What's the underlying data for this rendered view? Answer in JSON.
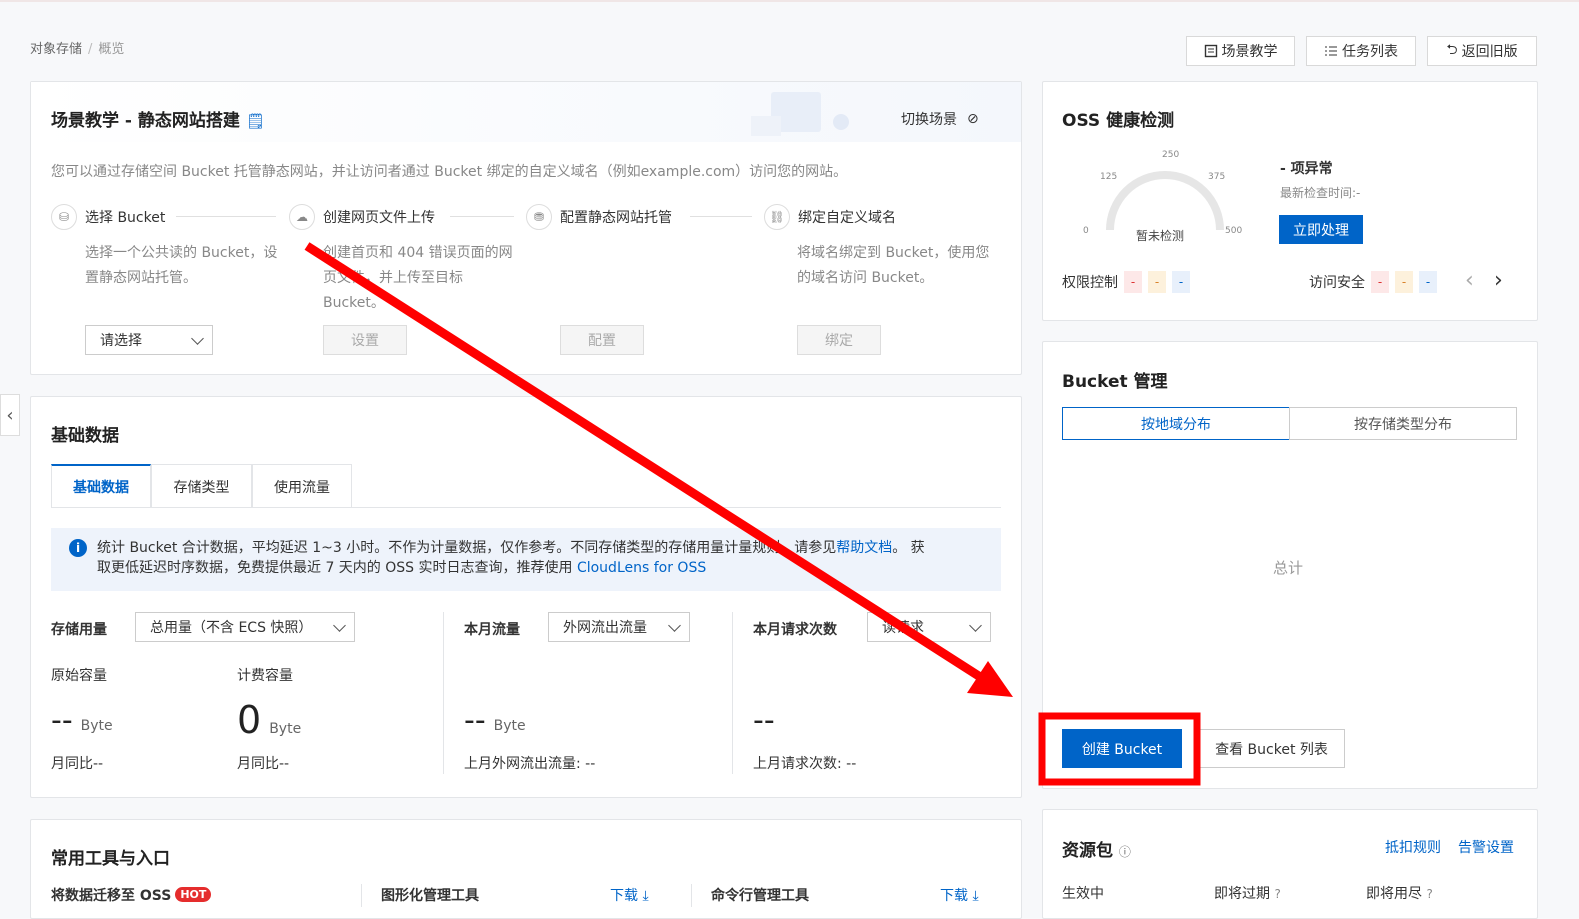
{
  "breadcrumb": {
    "root": "对象存储",
    "separator": "/",
    "current": "概览"
  },
  "toolbar": {
    "scene_teaching": "场景教学",
    "task_list": "任务列表",
    "back_old": "返回旧版"
  },
  "scene": {
    "title": "场景教学 - 静态网站搭建",
    "switch_label": "切换场景",
    "description": "您可以通过存储空间 Bucket 托管静态网站，并让访问者通过 Bucket 绑定的自定义域名（例如example.com）访问您的网站。",
    "steps": [
      {
        "title": "选择 Bucket",
        "desc_lines": [
          "选择一个公共读的 Bucket，设",
          "置静态网站托管。"
        ],
        "action": "请选择"
      },
      {
        "title": "创建网页文件上传",
        "desc_lines": [
          "创建首页和 404 错误页面的网",
          "页文件，并上传至目标",
          "Bucket。"
        ],
        "action": "设置"
      },
      {
        "title": "配置静态网站托管",
        "desc_lines": [],
        "action": "配置"
      },
      {
        "title": "绑定自定义域名",
        "desc_lines": [
          "将域名绑定到 Bucket，使用您",
          "的域名访问 Bucket。"
        ],
        "action": "绑定"
      }
    ]
  },
  "health": {
    "title": "OSS 健康检测",
    "gauge": {
      "ticks": [
        "0",
        "125",
        "250",
        "375",
        "500"
      ],
      "center": "暂未检测"
    },
    "abnormal": "- 项异常",
    "last_check": "最新检查时间:-",
    "handle_btn": "立即处理",
    "perm_label": "权限控制",
    "access_label": "访问安全",
    "tag_value": "-"
  },
  "basic": {
    "title": "基础数据",
    "tabs": [
      "基础数据",
      "存储类型",
      "使用流量"
    ],
    "notice_pre": "统计 Bucket 合计数据，平均延迟 1~3 小时。不作为计量数据，仅作参考。不同存储类型的存储用量计量规则，请参见",
    "notice_link1": "帮助文档",
    "notice_mid": "。 获",
    "notice_line2": "取更低延迟时序数据，免费提供最近 7 天内的 OSS 实时日志查询，推荐使用 ",
    "notice_link2": "CloudLens for OSS",
    "storage_label": "存储用量",
    "storage_select": "总用量（不含 ECS 快照）",
    "raw_cap_label": "原始容量",
    "raw_cap_value": "--",
    "raw_cap_unit": "Byte",
    "raw_cap_mom": "月同比--",
    "bill_cap_label": "计费容量",
    "bill_cap_value": "0",
    "bill_cap_unit": "Byte",
    "bill_cap_mom": "月同比--",
    "traffic_label": "本月流量",
    "traffic_select": "外网流出流量",
    "traffic_value": "--",
    "traffic_unit": "Byte",
    "traffic_last": "上月外网流出流量: --",
    "req_label": "本月请求次数",
    "req_select": "读请求",
    "req_value": "--",
    "req_last": "上月请求次数: --"
  },
  "bucket": {
    "title": "Bucket 管理",
    "tab_region": "按地域分布",
    "tab_type": "按存储类型分布",
    "total": "总计",
    "create_btn": "创建 Bucket",
    "list_btn": "查看 Bucket 列表"
  },
  "tools": {
    "title": "常用工具与入口",
    "migrate": "将数据迁移至 OSS",
    "hot": "HOT",
    "gui_tool": "图形化管理工具",
    "cli_tool": "命令行管理工具",
    "download": "下载"
  },
  "resource": {
    "title": "资源包",
    "rules": "抵扣规则",
    "alarm": "告警设置",
    "active": "生效中",
    "expiring": "即将过期",
    "exhausting": "即将用尽"
  },
  "colors": {
    "primary": "#0064c8",
    "annotation_red": "#ff0000"
  }
}
